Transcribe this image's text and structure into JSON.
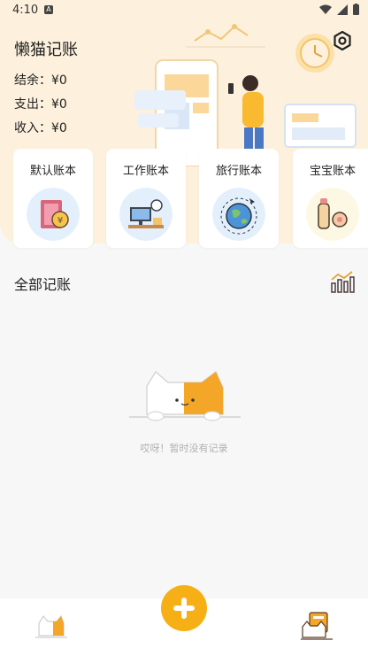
{
  "status_bar": {
    "time": "4:10",
    "notification_glyph": "A"
  },
  "header": {
    "title": "懒猫记账",
    "balance": "结余：¥0",
    "expense": "支出：¥0",
    "income": "收入：¥0"
  },
  "books": [
    {
      "label": "默认账本",
      "icon": "money-book-icon"
    },
    {
      "label": "工作账本",
      "icon": "computer-desk-icon"
    },
    {
      "label": "旅行账本",
      "icon": "globe-plane-icon"
    },
    {
      "label": "宝宝账本",
      "icon": "baby-bottle-icon"
    }
  ],
  "section": {
    "title": "全部记账"
  },
  "empty_state": {
    "message": "哎呀！暂时没有记录"
  },
  "colors": {
    "accent": "#f6b016",
    "header_bg": "#fdf1dd"
  }
}
